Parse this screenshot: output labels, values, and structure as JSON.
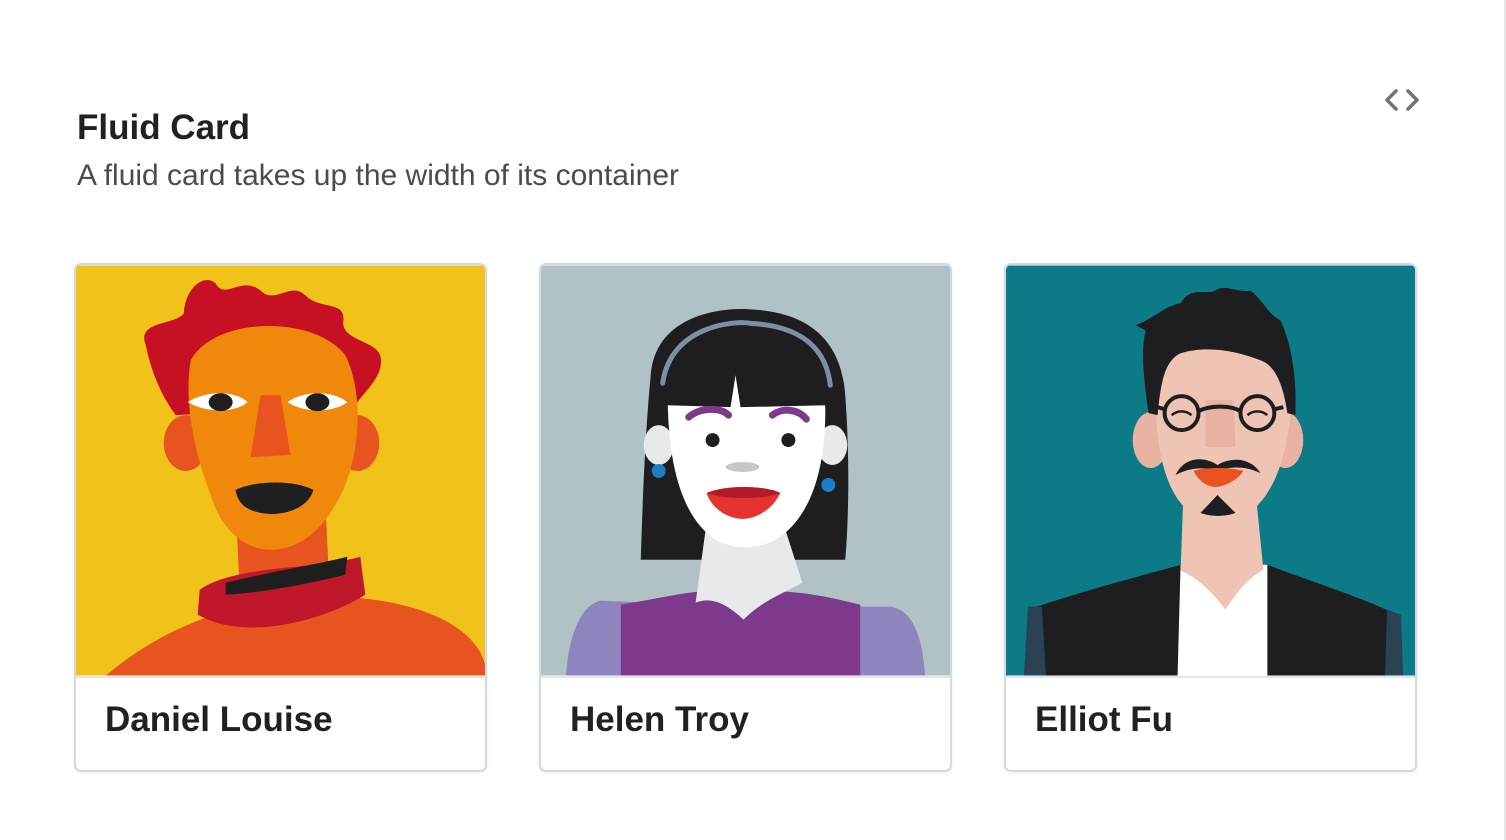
{
  "header": {
    "title": "Fluid Card",
    "subtitle": "A fluid card takes up the width of its container"
  },
  "toolbar": {
    "code_toggle_icon": "code-brackets-icon"
  },
  "cards": [
    {
      "name": "Daniel Louise",
      "illustration": "portrait-daniel-louise",
      "background": "#f0c21a"
    },
    {
      "name": "Helen Troy",
      "illustration": "portrait-helen-troy",
      "background": "#b0c2c6"
    },
    {
      "name": "Elliot Fu",
      "illustration": "portrait-elliot-fu",
      "background": "#0c7a87"
    }
  ]
}
